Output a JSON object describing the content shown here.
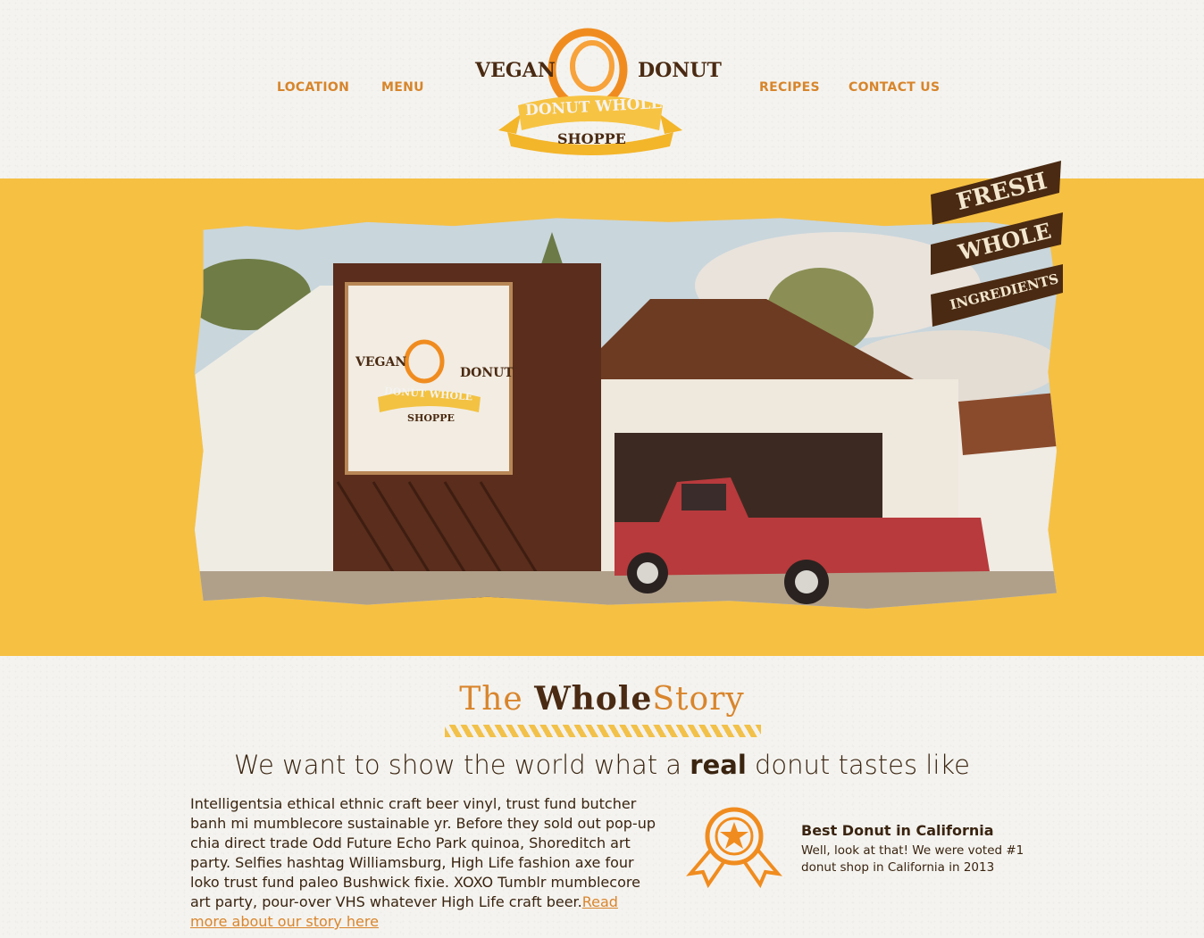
{
  "nav": {
    "location": "LOCATION",
    "menu": "MENU",
    "recipes": "RECIPES",
    "contact": "CONTACT US"
  },
  "logo": {
    "vegan": "VEGAN",
    "donut": "DONUT",
    "banner": "DONUT WHOLE",
    "shoppe": "SHOPPE"
  },
  "hero": {
    "ribbons": [
      "FRESH",
      "WHOLE",
      "INGREDIENTS"
    ],
    "photo_sign": {
      "vegan": "VEGAN",
      "donut": "DONUT",
      "banner": "DONUT WHOLE",
      "shoppe": "SHOPPE"
    }
  },
  "story": {
    "title_part1": "The ",
    "title_part2": "Whole",
    "title_part3": "Story",
    "tagline_before": "We want to show the world what a ",
    "tagline_bold": "real",
    "tagline_after": " donut tastes like",
    "body": "Intelligentsia ethical ethnic craft beer vinyl, trust fund butcher banh mi mumblecore sustainable yr. Before they sold out pop-up chia direct trade Odd Future Echo Park quinoa, Shoreditch art party. Selfies hashtag Williamsburg, High Life fashion axe four loko trust fund paleo Bushwick fixie. XOXO Tumblr mumblecore art party, pour-over VHS whatever High Life craft beer.",
    "read_more": "Read more about our story here"
  },
  "award": {
    "title": "Best Donut in California",
    "text": "Well, look at that! We were voted #1 donut shop in California in 2013"
  },
  "colors": {
    "accent": "#d9852c",
    "hero_yellow": "#f6c043",
    "dark_brown": "#4a2a12",
    "background": "#f4f3ef"
  }
}
